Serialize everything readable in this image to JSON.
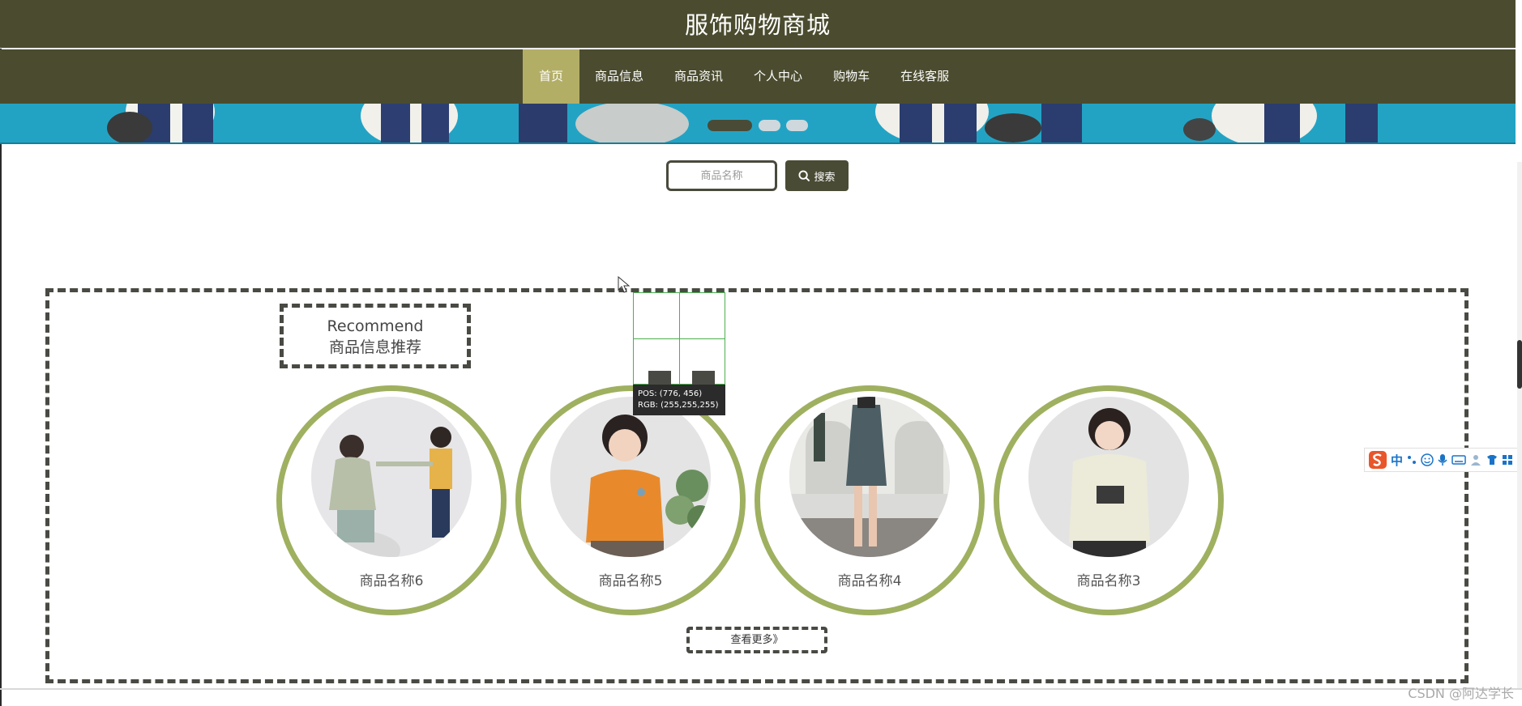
{
  "site": {
    "title": "服饰购物商城"
  },
  "nav": {
    "items": [
      {
        "label": "首页",
        "active": true
      },
      {
        "label": "商品信息",
        "active": false
      },
      {
        "label": "商品资讯",
        "active": false
      },
      {
        "label": "个人中心",
        "active": false
      },
      {
        "label": "购物车",
        "active": false
      },
      {
        "label": "在线客服",
        "active": false
      }
    ]
  },
  "banner": {
    "slides": 3,
    "active_slide": 1
  },
  "search": {
    "placeholder": "商品名称",
    "button_label": "搜索"
  },
  "recommend": {
    "title_en": "Recommend",
    "title_cn": "商品信息推荐",
    "products": [
      {
        "name": "商品名称6"
      },
      {
        "name": "商品名称5"
      },
      {
        "name": "商品名称4"
      },
      {
        "name": "商品名称3"
      }
    ],
    "more_label": "查看更多》"
  },
  "color_picker": {
    "pos": "POS:  (776, 456)",
    "rgb": "RGB:  (255,255,255)"
  },
  "ime": {
    "mode": "中"
  },
  "watermark": "CSDN @阿达学长",
  "colors": {
    "header": "#4b4c2f",
    "nav_active": "#b3ae66",
    "circle_border": "#9fb060",
    "banner": "#2eaccb"
  }
}
